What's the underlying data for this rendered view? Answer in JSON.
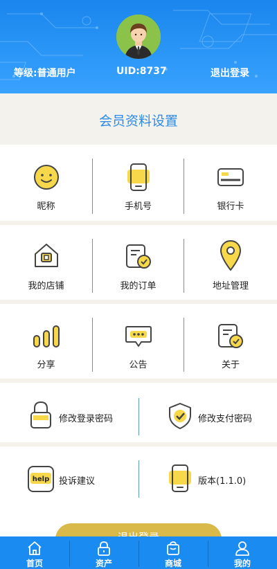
{
  "header": {
    "level": "等级:普通用户",
    "uid": "UID:8737",
    "logout": "退出登录"
  },
  "section_title": "会员资料设置",
  "row1": [
    "昵称",
    "手机号",
    "银行卡"
  ],
  "row2": [
    "我的店铺",
    "我的订单",
    "地址管理"
  ],
  "row3": [
    "分享",
    "公告",
    "关于"
  ],
  "row4": [
    "修改登录密码",
    "修改支付密码"
  ],
  "row5": [
    "投诉建议",
    "版本(1.1.0)"
  ],
  "help_badge": "help",
  "logout_button": "退出登录",
  "tabbar": [
    "首页",
    "资产",
    "商城",
    "我的"
  ],
  "icons": {
    "nickname": "smiley-icon",
    "phone": "phone-icon",
    "bank": "bank-card-icon",
    "shop": "shop-icon",
    "orders": "order-icon",
    "address": "location-pin-icon",
    "share": "bar-chart-icon",
    "notice": "chat-bubble-icon",
    "about": "document-check-icon",
    "login_pwd": "lock-icon",
    "pay_pwd": "shield-check-icon",
    "feedback": "help-icon",
    "version": "phone-icon"
  },
  "colors": {
    "accent_blue": "#1a8bf0",
    "title_blue": "#2f8be6",
    "yellow": "#f7d84a",
    "button_gold": "#d9b94a"
  }
}
